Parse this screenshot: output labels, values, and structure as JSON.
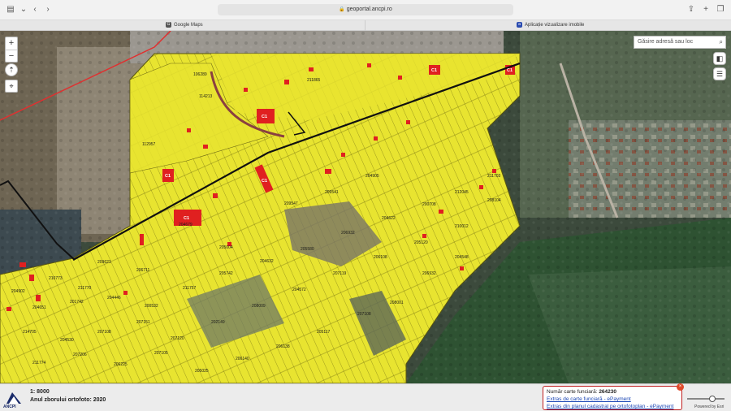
{
  "browser": {
    "url": "geoportal.ancpi.ro",
    "tabs": [
      {
        "label": "Google Maps"
      },
      {
        "label": "Aplicație vizualizare imobile"
      }
    ]
  },
  "map": {
    "search_placeholder": "Găsire adresă sau loc",
    "zoom_in": "+",
    "zoom_out": "−",
    "parcel_labels": [
      "106289",
      "112957",
      "114213",
      "211865",
      "204679",
      "205004",
      "206711",
      "209621",
      "210773",
      "211770",
      "204902",
      "204651",
      "201742",
      "204446",
      "200532",
      "211757",
      "205742",
      "204632",
      "205580",
      "206932",
      "204622",
      "200708",
      "212045",
      "211703",
      "214705",
      "204530",
      "207108",
      "207151",
      "207120",
      "202149",
      "208009",
      "204572",
      "207119",
      "206108",
      "205120",
      "210012",
      "211774",
      "207206",
      "206225",
      "207105",
      "205025",
      "206140",
      "206138",
      "205117",
      "207108",
      "208001",
      "206932",
      "204548",
      "208104",
      "204905",
      "209541",
      "209547"
    ],
    "building_labels": [
      "C1",
      "C1",
      "C1",
      "C1",
      "C1",
      "C1"
    ]
  },
  "status": {
    "scale": "1: 8000",
    "ortho_year": "Anul zborului ortofoto: 2020",
    "logo_text": "ANCPI"
  },
  "info_panel": {
    "label": "Număr carte funciară:",
    "number": "264230",
    "link1": "Extras de carte funciară - ePayment",
    "link2": "Extras din planul cadastral pe ortofotoplan - ePayment",
    "close_label": "×"
  },
  "attribution": "Powered by Esri",
  "colors": {
    "parcel_fill": "#e8e430",
    "building": "#e02020",
    "boundary": "#111111",
    "admin_line": "#e03030",
    "forest": "#2e5232"
  }
}
